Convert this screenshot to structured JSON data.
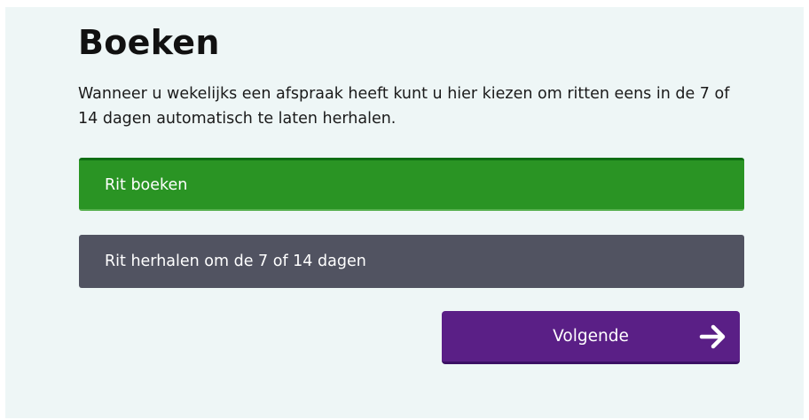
{
  "page": {
    "title": "Boeken",
    "description": "Wanneer u wekelijks een afspraak heeft kunt u hier kiezen om ritten eens in de 7 of 14 dagen automatisch te laten herhalen."
  },
  "options": [
    {
      "label": "Rit boeken",
      "selected": true
    },
    {
      "label": "Rit herhalen om de 7 of 14 dagen",
      "selected": false
    }
  ],
  "next_button": {
    "label": "Volgende",
    "icon": "arrow-right-icon"
  },
  "colors": {
    "background": "#eef6f6",
    "selected_option": "#2a9424",
    "unselected_option": "#515361",
    "next_button": "#5a1f86"
  }
}
